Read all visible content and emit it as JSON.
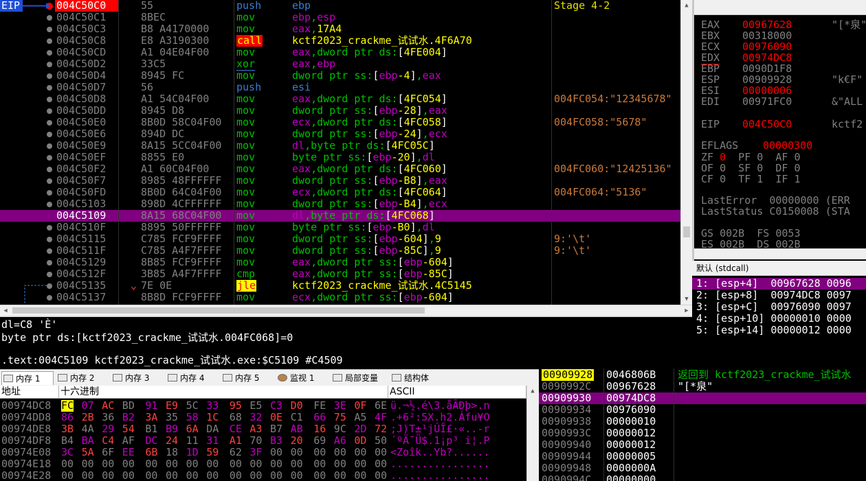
{
  "disasm": {
    "eip_label": "EIP",
    "rows": [
      {
        "addr": "004C50C0",
        "bytes": "55",
        "mn": "push",
        "ops": "ebp",
        "cmt": "Stage 4-2",
        "cls": "push"
      },
      {
        "addr": "004C50C1",
        "bytes": "8BEC",
        "mn": "mov",
        "ops": "ebp,esp",
        "cmt": ""
      },
      {
        "addr": "004C50C3",
        "bytes": "B8 A4170000",
        "mn": "mov",
        "ops": "eax,17A4",
        "cmt": ""
      },
      {
        "addr": "004C50C8",
        "bytes": "E8 A3190300",
        "mn": "call",
        "ops": "kctf2023_crackme_试试水.4F6A70",
        "cmt": "",
        "cls": "call"
      },
      {
        "addr": "004C50CD",
        "bytes": "A1 04E04F00",
        "mn": "mov",
        "ops": "eax,dword ptr ds:[4FE004]",
        "cmt": ""
      },
      {
        "addr": "004C50D2",
        "bytes": "33C5",
        "mn": "xor",
        "ops": "eax,ebp",
        "cmt": ""
      },
      {
        "addr": "004C50D4",
        "bytes": "8945 FC",
        "mn": "mov",
        "ops": "dword ptr ss:[ebp-4],eax",
        "cmt": ""
      },
      {
        "addr": "004C50D7",
        "bytes": "56",
        "mn": "push",
        "ops": "esi",
        "cmt": "",
        "cls": "push"
      },
      {
        "addr": "004C50D8",
        "bytes": "A1 54C04F00",
        "mn": "mov",
        "ops": "eax,dword ptr ds:[4FC054]",
        "cmt": "004FC054:\"12345678\""
      },
      {
        "addr": "004C50DD",
        "bytes": "8945 D8",
        "mn": "mov",
        "ops": "dword ptr ss:[ebp-28],eax",
        "cmt": ""
      },
      {
        "addr": "004C50E0",
        "bytes": "8B0D 58C04F00",
        "mn": "mov",
        "ops": "ecx,dword ptr ds:[4FC058]",
        "cmt": "004FC058:\"5678\""
      },
      {
        "addr": "004C50E6",
        "bytes": "894D DC",
        "mn": "mov",
        "ops": "dword ptr ss:[ebp-24],ecx",
        "cmt": ""
      },
      {
        "addr": "004C50E9",
        "bytes": "8A15 5CC04F00",
        "mn": "mov",
        "ops": "dl,byte ptr ds:[4FC05C]",
        "cmt": ""
      },
      {
        "addr": "004C50EF",
        "bytes": "8855 E0",
        "mn": "mov",
        "ops": "byte ptr ss:[ebp-20],dl",
        "cmt": ""
      },
      {
        "addr": "004C50F2",
        "bytes": "A1 60C04F00",
        "mn": "mov",
        "ops": "eax,dword ptr ds:[4FC060]",
        "cmt": "004FC060:\"12425136\""
      },
      {
        "addr": "004C50F7",
        "bytes": "8985 48FFFFFF",
        "mn": "mov",
        "ops": "dword ptr ss:[ebp-B8],eax",
        "cmt": ""
      },
      {
        "addr": "004C50FD",
        "bytes": "8B0D 64C04F00",
        "mn": "mov",
        "ops": "ecx,dword ptr ds:[4FC064]",
        "cmt": "004FC064:\"5136\""
      },
      {
        "addr": "004C5103",
        "bytes": "898D 4CFFFFFF",
        "mn": "mov",
        "ops": "dword ptr ss:[ebp-B4],ecx",
        "cmt": ""
      },
      {
        "addr": "004C5109",
        "bytes": "8A15 68C04F00",
        "mn": "mov",
        "ops": "dl,byte ptr ds:[4FC068]",
        "cmt": "",
        "cls": "hl"
      },
      {
        "addr": "004C510F",
        "bytes": "8895 50FFFFFF",
        "mn": "mov",
        "ops": "byte ptr ss:[ebp-B0],dl",
        "cmt": ""
      },
      {
        "addr": "004C5115",
        "bytes": "C785 FCF9FFFF",
        "mn": "mov",
        "ops": "dword ptr ss:[ebp-604],9",
        "cmt": "9:'\\t'"
      },
      {
        "addr": "004C511F",
        "bytes": "C785 A4F7FFFF",
        "mn": "mov",
        "ops": "dword ptr ss:[ebp-85C],9",
        "cmt": "9:'\\t'"
      },
      {
        "addr": "004C5129",
        "bytes": "8B85 FCF9FFFF",
        "mn": "mov",
        "ops": "eax,dword ptr ss:[ebp-604]",
        "cmt": ""
      },
      {
        "addr": "004C512F",
        "bytes": "3B85 A4F7FFFF",
        "mn": "cmp",
        "ops": "eax,dword ptr ss:[ebp-85C]",
        "cmt": ""
      },
      {
        "addr": "004C5135",
        "bytes": "7E 0E",
        "mn": "jle",
        "ops": "kctf2023_crackme_试试水.4C5145",
        "cmt": "",
        "cls": "jle"
      },
      {
        "addr": "004C5137",
        "bytes": "8B8D FCF9FFFF",
        "mn": "mov",
        "ops": "ecx,dword ptr ss:[ebp-604]",
        "cmt": ""
      }
    ]
  },
  "registers": {
    "rows": [
      {
        "name": "EAX",
        "val": "00967628",
        "red": true,
        "str": "\"[*泉\""
      },
      {
        "name": "EBX",
        "val": "00318000",
        "red": false,
        "str": ""
      },
      {
        "name": "ECX",
        "val": "00976090",
        "red": true,
        "str": ""
      },
      {
        "name": "EDX",
        "val": "00974DC8",
        "red": true,
        "str": ""
      },
      {
        "name": "EBP",
        "val": "0090D1F8",
        "red": false,
        "str": ""
      },
      {
        "name": "ESP",
        "val": "00909928",
        "red": false,
        "str": "\"k€F\""
      },
      {
        "name": "ESI",
        "val": "00000006",
        "red": true,
        "str": ""
      },
      {
        "name": "EDI",
        "val": "00971FC0",
        "red": false,
        "str": "&\"ALL"
      }
    ],
    "eip": {
      "name": "EIP",
      "val": "004C50C0",
      "str": "kctf2"
    },
    "eflags": {
      "name": "EFLAGS",
      "val": "00000300"
    },
    "flags1": "ZF 0  PF 0  AF 0",
    "flags2": "OF 0  SF 0  DF 0",
    "flags3": "CF 0  TF 1  IF 1",
    "lasterror": "LastError  00000000 (ERR",
    "laststatus": "LastStatus C0150008 (STA",
    "seg1": "GS 002B  FS 0053",
    "seg2": "ES 002B  DS 002B"
  },
  "callconv": {
    "header": "默认 (stdcall)",
    "rows": [
      "1: [esp+4]  00967628 0096",
      "2: [esp+8]  00974DC8 0097",
      "3: [esp+C]  00976090 0097",
      "4: [esp+10] 00000010 0000",
      "5: [esp+14] 00000012 0000"
    ]
  },
  "info": {
    "line1": "dl=C8 'È'",
    "line2": "byte ptr ds:[kctf2023_crackme_试试水.004FC068]=0",
    "line3": ".text:004C5109 kctf2023_crackme_试试水.exe:$C5109 #C4509"
  },
  "tabs": [
    {
      "label": "内存 1",
      "active": true
    },
    {
      "label": "内存 2"
    },
    {
      "label": "内存 3"
    },
    {
      "label": "内存 4"
    },
    {
      "label": "内存 5"
    },
    {
      "label": "监视 1"
    },
    {
      "label": "局部变量"
    },
    {
      "label": "结构体"
    }
  ],
  "dump": {
    "col_addr": "地址",
    "col_hex": "十六进制",
    "col_ascii": "ASCII",
    "rows": [
      {
        "addr": "00974DC8",
        "hex": [
          "FC",
          "07",
          "AC",
          "BD",
          "91",
          "E9",
          "5C",
          "33",
          "95",
          "E5",
          "C3",
          "D0",
          "FE",
          "3E",
          "0F",
          "6E"
        ],
        "ascii": "ü.¬½.é\\3.åÃÐþ>.n"
      },
      {
        "addr": "00974DD8",
        "hex": [
          "86",
          "2B",
          "36",
          "B2",
          "3A",
          "35",
          "58",
          "1C",
          "68",
          "32",
          "0E",
          "C1",
          "66",
          "75",
          "A5",
          "4F"
        ],
        "ascii": ".+6²:5X.h2.Áfu¥O"
      },
      {
        "addr": "00974DE8",
        "hex": [
          "3B",
          "4A",
          "29",
          "54",
          "B1",
          "B9",
          "6A",
          "DA",
          "CE",
          "A3",
          "B7",
          "AB",
          "16",
          "9C",
          "2D",
          "72"
        ],
        "ascii": ";J)T±¹jÚÎ£·«..-r"
      },
      {
        "addr": "00974DF8",
        "hex": [
          "B4",
          "BA",
          "C4",
          "AF",
          "DC",
          "24",
          "11",
          "31",
          "A1",
          "70",
          "B3",
          "20",
          "69",
          "A6",
          "0D",
          "50"
        ],
        "ascii": "´ºÄ¯Ü$.1¡p³ i¦.P"
      },
      {
        "addr": "00974E08",
        "hex": [
          "3C",
          "5A",
          "6F",
          "EE",
          "6B",
          "18",
          "1D",
          "59",
          "62",
          "3F",
          "00",
          "00",
          "00",
          "00",
          "00",
          "00"
        ],
        "ascii": "<Zoîk..Yb?......"
      },
      {
        "addr": "00974E18",
        "hex": [
          "00",
          "00",
          "00",
          "00",
          "00",
          "00",
          "00",
          "00",
          "00",
          "00",
          "00",
          "00",
          "00",
          "00",
          "00",
          "00"
        ],
        "ascii": "................"
      },
      {
        "addr": "00974E28",
        "hex": [
          "00",
          "00",
          "00",
          "00",
          "00",
          "00",
          "00",
          "00",
          "00",
          "00",
          "00",
          "00",
          "00",
          "00",
          "00",
          "00"
        ],
        "ascii": "................"
      }
    ]
  },
  "stack": {
    "rows": [
      {
        "addr": "00909928",
        "val": "0046806B",
        "cmt": "返回到 kctf2023_crackme_试试水"
      },
      {
        "addr": "0090992C",
        "val": "00967628",
        "cmt": "\"[*泉\""
      },
      {
        "addr": "00909930",
        "val": "00974DC8",
        "cmt": ""
      },
      {
        "addr": "00909934",
        "val": "00976090",
        "cmt": ""
      },
      {
        "addr": "00909938",
        "val": "00000010",
        "cmt": ""
      },
      {
        "addr": "0090993C",
        "val": "00000012",
        "cmt": ""
      },
      {
        "addr": "00909940",
        "val": "00000012",
        "cmt": ""
      },
      {
        "addr": "00909944",
        "val": "00000005",
        "cmt": ""
      },
      {
        "addr": "00909948",
        "val": "0000000A",
        "cmt": ""
      },
      {
        "addr": "0090994C",
        "val": "00000000",
        "cmt": ""
      }
    ]
  }
}
